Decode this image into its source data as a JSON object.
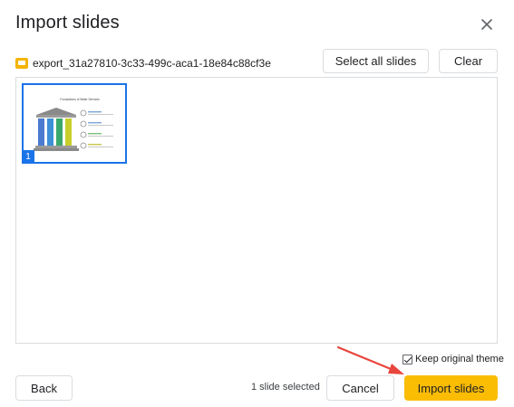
{
  "dialog": {
    "title": "Import slides",
    "close_icon": "close-icon"
  },
  "file": {
    "icon": "slides-file-icon",
    "icon_color": "#F4B400",
    "name": "export_31a27810-3c33-499c-aca1-18e84c88cf3e"
  },
  "toolbar": {
    "select_all_label": "Select all slides",
    "clear_label": "Clear"
  },
  "slides": [
    {
      "number": "1",
      "selected": true,
      "thumbnail_title": "Foundations of Water Services"
    }
  ],
  "options": {
    "keep_theme_label": "Keep original theme",
    "keep_theme_checked": true
  },
  "footer": {
    "back_label": "Back",
    "status": "1 slide selected",
    "cancel_label": "Cancel",
    "import_label": "Import slides"
  },
  "colors": {
    "accent": "#1A73E8",
    "primary_button": "#FBBC04",
    "annotation_arrow": "#E8453C"
  }
}
